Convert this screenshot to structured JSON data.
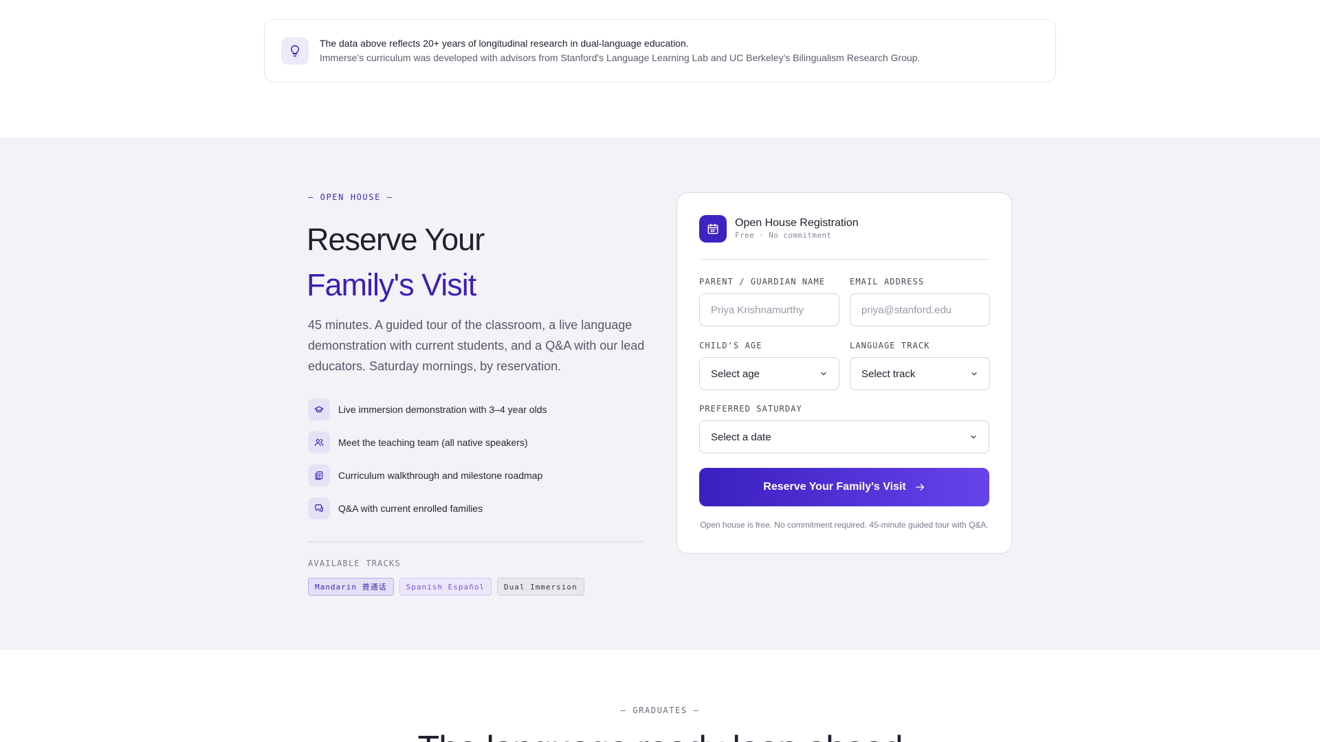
{
  "note": {
    "line1": "The data above reflects 20+ years of longitudinal research in dual-language education.",
    "line2": "Immerse's curriculum was developed with advisors from Stanford's Language Learning Lab and UC Berkeley's Bilingualism Research Group."
  },
  "open_house": {
    "eyebrow": "— OPEN HOUSE —",
    "headline_1": "Reserve Your",
    "headline_2": "Family's Visit",
    "lead": "45 minutes. A guided tour of the classroom, a live language demonstration with current students, and a Q&A with our lead educators. Saturday mornings, by reservation.",
    "features": [
      {
        "icon": "graduation-cap-icon",
        "text": "Live immersion demonstration with 3–4 year olds"
      },
      {
        "icon": "users-icon",
        "text": "Meet the teaching team (all native speakers)"
      },
      {
        "icon": "documents-icon",
        "text": "Curriculum walkthrough and milestone roadmap"
      },
      {
        "icon": "chat-icon",
        "text": "Q&A with current enrolled families"
      }
    ],
    "tracks_label": "AVAILABLE TRACKS",
    "tracks": [
      "Mandarin 普通话",
      "Spanish Español",
      "Dual Immersion"
    ]
  },
  "form": {
    "title": "Open House Registration",
    "subtitle": "Free · No commitment",
    "name_label": "PARENT / GUARDIAN NAME",
    "name_placeholder": "Priya Krishnamurthy",
    "email_label": "EMAIL ADDRESS",
    "email_placeholder": "priya@stanford.edu",
    "age_label": "CHILD'S AGE",
    "age_value": "Select age",
    "track_label": "LANGUAGE TRACK",
    "track_value": "Select track",
    "saturday_label": "PREFERRED SATURDAY",
    "saturday_value": "Select a date",
    "submit_label": "Reserve Your Family's Visit",
    "fine_print": "Open house is free. No commitment required. 45-minute guided tour with Q&A."
  },
  "graduates": {
    "eyebrow": "— GRADUATES —",
    "title": "The language ready leap ahead"
  },
  "colors": {
    "accent": "#3c1fb5",
    "band_bg": "#f3f2f7"
  }
}
